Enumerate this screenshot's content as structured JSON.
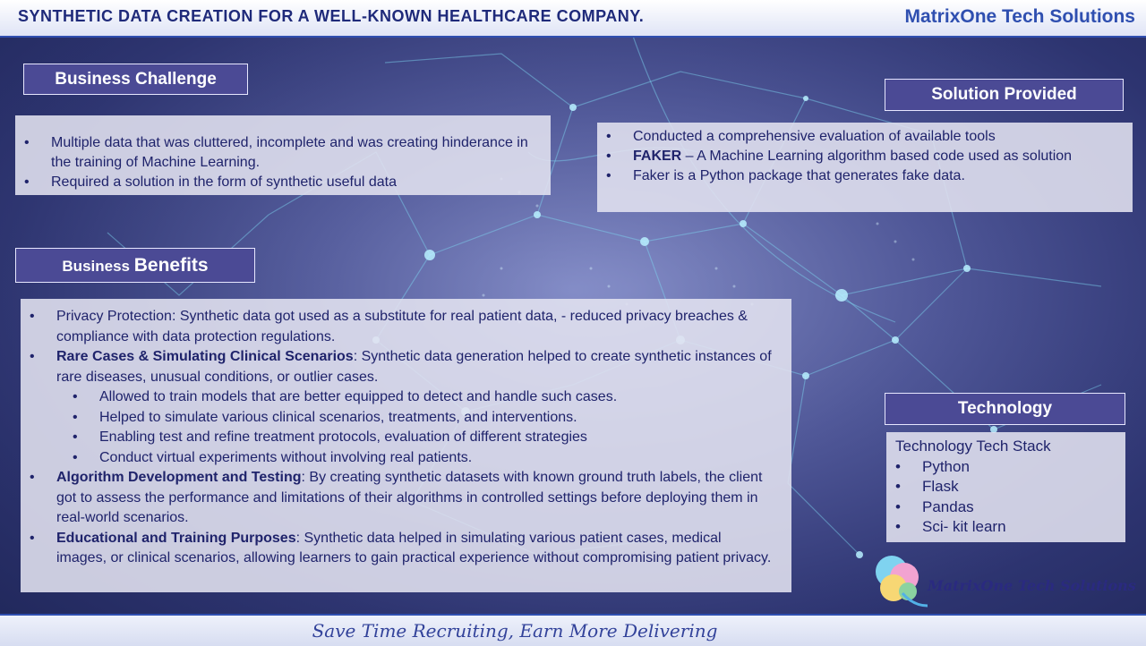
{
  "header": {
    "title": "SYNTHETIC  DATA CREATION  FOR A WELL-KNOWN HEALTHCARE  COMPANY.",
    "brand": "MatrixOne Tech Solutions"
  },
  "business_challenge": {
    "heading": "Business Challenge",
    "items": [
      "Multiple data that was cluttered, incomplete and was creating hinderance in the training of Machine Learning.",
      "Required a solution in the form of synthetic useful data"
    ]
  },
  "solution": {
    "heading": "Solution  Provided",
    "item1": "Conducted a comprehensive evaluation of available tools",
    "item2_bold": "FAKER",
    "item2_rest": " – A Machine Learning algorithm based code used as solution",
    "item3": "Faker is a Python package that generates fake data."
  },
  "business_benefits": {
    "heading_small": "Business ",
    "heading_big": "Benefits",
    "b1_text": "Privacy Protection: Synthetic data got used as a substitute for real patient data, - reduced privacy breaches & compliance with data protection regulations.",
    "b2_bold": "Rare Cases & Simulating Clinical Scenarios",
    "b2_text": ": Synthetic data generation helped to create synthetic instances of rare diseases, unusual conditions, or outlier cases.",
    "b2_sub": [
      "Allowed to train models that are better equipped to detect and handle such cases.",
      "Helped to simulate various clinical scenarios, treatments, and interventions.",
      "Enabling test and refine treatment protocols, evaluation of different strategies",
      "Conduct virtual  experiments without involving real patients."
    ],
    "b3_bold": "Algorithm Development and Testing",
    "b3_text": ": By creating synthetic datasets with known ground truth labels, the client got to assess the performance and limitations of their algorithms in controlled settings before deploying them in real-world scenarios.",
    "b4_bold": "Educational and Training Purposes",
    "b4_text": ": Synthetic data helped in simulating various patient cases, medical images, or clinical scenarios, allowing learners to gain practical experience without compromising patient privacy."
  },
  "technology": {
    "heading": "Technology",
    "intro": "Technology Tech Stack",
    "items": [
      "Python",
      "Flask",
      "Pandas",
      "Sci- kit learn"
    ]
  },
  "logo": {
    "text": "MatrixOne Tech Solutions"
  },
  "footer": {
    "tagline": "Save Time Recruiting, Earn More Delivering"
  }
}
